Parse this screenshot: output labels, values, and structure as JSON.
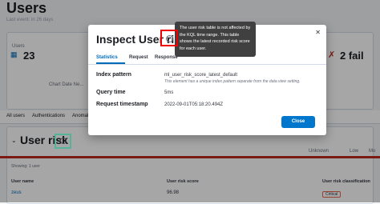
{
  "page": {
    "title": "Users",
    "subtitle": "Last event: in 26 days"
  },
  "kpi": {
    "users_label": "Users",
    "users_value": "23",
    "fail_value": "2 fail"
  },
  "table_hint": "Chart Date Ne...",
  "bg_tabs": [
    "All users",
    "Authentications",
    "Anomal"
  ],
  "user_risk": {
    "title": "User risk",
    "legend": [
      "Unknown",
      "Low",
      "Mo"
    ],
    "showing": "Showing: 1 user",
    "columns": [
      "User name",
      "User risk score",
      "User risk classification"
    ],
    "rows": [
      {
        "user": "zeus",
        "score": "96.98",
        "classification": "Critical"
      }
    ]
  },
  "modal": {
    "title": "Inspect User risk",
    "tabs": [
      "Statistics",
      "Request",
      "Response"
    ],
    "fields": [
      {
        "label": "Index pattern",
        "value": "ml_user_risk_score_latest_default",
        "note": "This element has a unique index pattern separate from the data view setting."
      },
      {
        "label": "Query time",
        "value": "5ms"
      },
      {
        "label": "Request timestamp",
        "value": "2022-09-01T05:18:20.494Z"
      }
    ],
    "close_label": "Close"
  },
  "tooltip": "The user risk table is not affected by the KQL time range. This table shows the latest recorded risk score for each user.",
  "colors": {
    "accent": "#0077cc",
    "critical": "#bd271e",
    "tooltip_bg": "#404040"
  }
}
